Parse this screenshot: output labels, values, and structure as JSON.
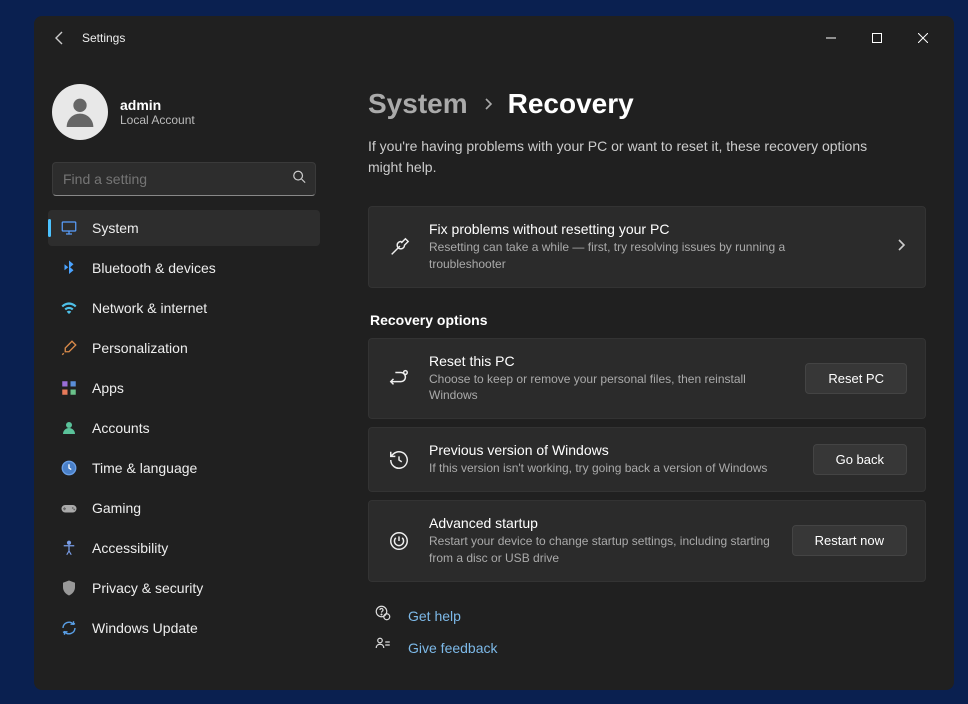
{
  "app": {
    "title": "Settings"
  },
  "profile": {
    "name": "admin",
    "sub": "Local Account"
  },
  "search": {
    "placeholder": "Find a setting"
  },
  "nav": [
    {
      "label": "System",
      "icon": "monitor",
      "active": true
    },
    {
      "label": "Bluetooth & devices",
      "icon": "bluetooth"
    },
    {
      "label": "Network & internet",
      "icon": "wifi"
    },
    {
      "label": "Personalization",
      "icon": "brush"
    },
    {
      "label": "Apps",
      "icon": "grid"
    },
    {
      "label": "Accounts",
      "icon": "person"
    },
    {
      "label": "Time & language",
      "icon": "clock"
    },
    {
      "label": "Gaming",
      "icon": "gamepad"
    },
    {
      "label": "Accessibility",
      "icon": "accessibility"
    },
    {
      "label": "Privacy & security",
      "icon": "shield"
    },
    {
      "label": "Windows Update",
      "icon": "update"
    }
  ],
  "breadcrumb": {
    "parent": "System",
    "current": "Recovery"
  },
  "intro": "If you're having problems with your PC or want to reset it, these recovery options might help.",
  "fix_card": {
    "title": "Fix problems without resetting your PC",
    "desc": "Resetting can take a while — first, try resolving issues by running a troubleshooter"
  },
  "section_header": "Recovery options",
  "options": [
    {
      "title": "Reset this PC",
      "desc": "Choose to keep or remove your personal files, then reinstall Windows",
      "button": "Reset PC",
      "icon": "reset"
    },
    {
      "title": "Previous version of Windows",
      "desc": "If this version isn't working, try going back a version of Windows",
      "button": "Go back",
      "icon": "history"
    },
    {
      "title": "Advanced startup",
      "desc": "Restart your device to change startup settings, including starting from a disc or USB drive",
      "button": "Restart now",
      "icon": "power"
    }
  ],
  "footer": {
    "help": "Get help",
    "feedback": "Give feedback"
  }
}
